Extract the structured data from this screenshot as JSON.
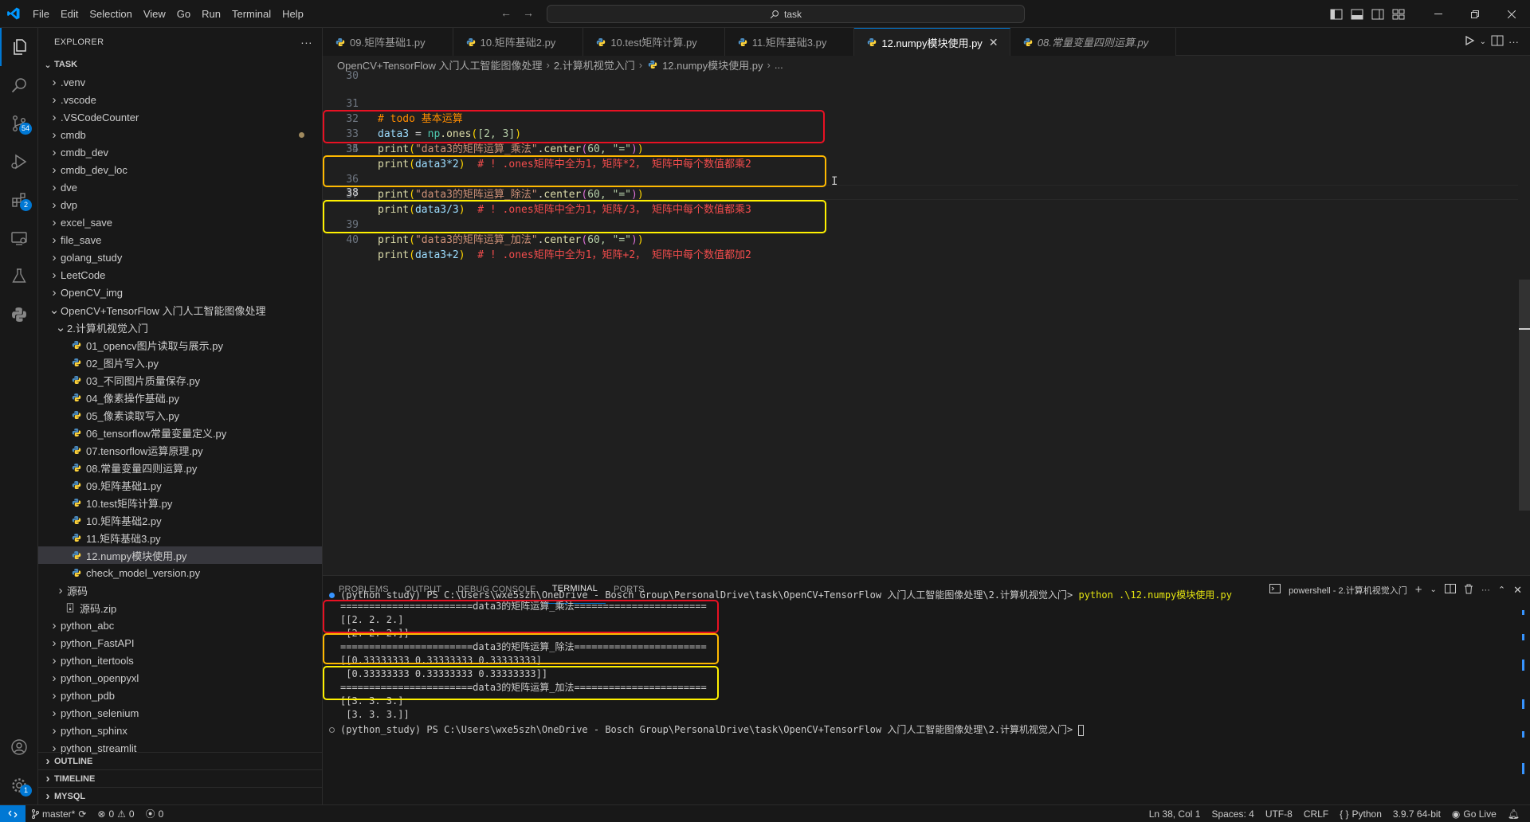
{
  "menu": [
    "File",
    "Edit",
    "Selection",
    "View",
    "Go",
    "Run",
    "Terminal",
    "Help"
  ],
  "nav": {
    "back": "←",
    "forward": "→"
  },
  "search": {
    "text": "task"
  },
  "explorer": {
    "title": "EXPLORER",
    "more": "···",
    "root": "TASK",
    "items": [
      {
        "label": ".venv",
        "kind": "folder",
        "depth": 1
      },
      {
        "label": ".vscode",
        "kind": "folder",
        "depth": 1
      },
      {
        "label": ".VSCodeCounter",
        "kind": "folder",
        "depth": 1
      },
      {
        "label": "cmdb",
        "kind": "folder",
        "depth": 1,
        "modified": true
      },
      {
        "label": "cmdb_dev",
        "kind": "folder",
        "depth": 1
      },
      {
        "label": "cmdb_dev_loc",
        "kind": "folder",
        "depth": 1
      },
      {
        "label": "dve",
        "kind": "folder",
        "depth": 1
      },
      {
        "label": "dvp",
        "kind": "folder",
        "depth": 1
      },
      {
        "label": "excel_save",
        "kind": "folder",
        "depth": 1
      },
      {
        "label": "file_save",
        "kind": "folder",
        "depth": 1
      },
      {
        "label": "golang_study",
        "kind": "folder",
        "depth": 1
      },
      {
        "label": "LeetCode",
        "kind": "folder",
        "depth": 1
      },
      {
        "label": "OpenCV_img",
        "kind": "folder",
        "depth": 1
      },
      {
        "label": "OpenCV+TensorFlow 入门人工智能图像处理",
        "kind": "folder-open",
        "depth": 1
      },
      {
        "label": "2.计算机视觉入门",
        "kind": "folder-open",
        "depth": 2
      },
      {
        "label": "01_opencv图片读取与展示.py",
        "kind": "py",
        "depth": 3
      },
      {
        "label": "02_图片写入.py",
        "kind": "py",
        "depth": 3
      },
      {
        "label": "03_不同图片质量保存.py",
        "kind": "py",
        "depth": 3
      },
      {
        "label": "04_像素操作基础.py",
        "kind": "py",
        "depth": 3
      },
      {
        "label": "05_像素读取写入.py",
        "kind": "py",
        "depth": 3
      },
      {
        "label": "06_tensorflow常量变量定义.py",
        "kind": "py",
        "depth": 3
      },
      {
        "label": "07.tensorflow运算原理.py",
        "kind": "py",
        "depth": 3
      },
      {
        "label": "08.常量变量四则运算.py",
        "kind": "py",
        "depth": 3
      },
      {
        "label": "09.矩阵基础1.py",
        "kind": "py",
        "depth": 3
      },
      {
        "label": "10.test矩阵计算.py",
        "kind": "py",
        "depth": 3
      },
      {
        "label": "10.矩阵基础2.py",
        "kind": "py",
        "depth": 3
      },
      {
        "label": "11.矩阵基础3.py",
        "kind": "py",
        "depth": 3
      },
      {
        "label": "12.numpy模块使用.py",
        "kind": "py",
        "depth": 3,
        "selected": true
      },
      {
        "label": "check_model_version.py",
        "kind": "py",
        "depth": 3
      },
      {
        "label": "源码",
        "kind": "folder",
        "depth": 2
      },
      {
        "label": "源码.zip",
        "kind": "zip",
        "depth": 2
      },
      {
        "label": "python_abc",
        "kind": "folder",
        "depth": 1
      },
      {
        "label": "python_FastAPI",
        "kind": "folder",
        "depth": 1
      },
      {
        "label": "python_itertools",
        "kind": "folder",
        "depth": 1
      },
      {
        "label": "python_openpyxl",
        "kind": "folder",
        "depth": 1
      },
      {
        "label": "python_pdb",
        "kind": "folder",
        "depth": 1
      },
      {
        "label": "python_selenium",
        "kind": "folder",
        "depth": 1
      },
      {
        "label": "python_sphinx",
        "kind": "folder",
        "depth": 1
      },
      {
        "label": "python_streamlit",
        "kind": "folder",
        "depth": 1
      }
    ],
    "sections": [
      "OUTLINE",
      "TIMELINE",
      "MYSQL"
    ]
  },
  "activity": {
    "scm_badge": "54",
    "ext_badge": "2",
    "settings_badge": "1"
  },
  "tabs": [
    {
      "label": "09.矩阵基础1.py",
      "active": false,
      "italic": false
    },
    {
      "label": "10.矩阵基础2.py",
      "active": false,
      "italic": false
    },
    {
      "label": "10.test矩阵计算.py",
      "active": false,
      "italic": false
    },
    {
      "label": "11.矩阵基础3.py",
      "active": false,
      "italic": false
    },
    {
      "label": "12.numpy模块使用.py",
      "active": true,
      "italic": false
    },
    {
      "label": "08.常量变量四则运算.py",
      "active": false,
      "italic": true
    }
  ],
  "breadcrumb": [
    "OpenCV+TensorFlow 入门人工智能图像处理",
    "2.计算机视觉入门",
    "12.numpy模块使用.py",
    "..."
  ],
  "editor": {
    "lines": [
      {
        "n": "30"
      },
      {
        "n": "31"
      },
      {
        "n": "32"
      },
      {
        "n": "33"
      },
      {
        "n": "34"
      },
      {
        "n": "35"
      },
      {
        "n": "36"
      },
      {
        "n": "37"
      },
      {
        "n": "38"
      },
      {
        "n": "39"
      },
      {
        "n": "40"
      }
    ],
    "todo_comment": "# todo 基本运算",
    "line32": {
      "var": "data3",
      "eq": " = ",
      "np": "np",
      "fn": ".ones",
      "args": "[2, 3]"
    },
    "line33": {
      "str": "\"data3的矩阵运算_乘法\"",
      "center_arg": "60, \"=\""
    },
    "line34": {
      "expr": "data3*2",
      "comment": "# ! .ones矩阵中全为1，矩阵*2， 矩阵中每个数值都乘2"
    },
    "line36": {
      "str": "\"data3的矩阵运算_除法\"",
      "center_arg": "60, \"=\""
    },
    "line37": {
      "expr": "data3/3",
      "comment": "# ! .ones矩阵中全为1，矩阵/3， 矩阵中每个数值都乘3"
    },
    "line39": {
      "str": "\"data3的矩阵运算_加法\"",
      "center_arg": "60, \"=\""
    },
    "line40": {
      "expr": "data3+2",
      "comment": "# ! .ones矩阵中全为1，矩阵+2， 矩阵中每个数值都加2"
    },
    "highlight_colors": {
      "red": "#e81123",
      "orange": "#ffb900",
      "yellow": "#fff100"
    }
  },
  "panel": {
    "tabs": [
      "PROBLEMS",
      "OUTPUT",
      "DEBUG CONSOLE",
      "TERMINAL",
      "PORTS"
    ],
    "active_tab": "TERMINAL",
    "shell_label": "powershell - 2.计算机视觉入门",
    "terminal": [
      "(python_study) PS C:\\Users\\wxe5szh\\OneDrive - Bosch Group\\PersonalDrive\\task\\OpenCV+TensorFlow 入门人工智能图像处理\\2.计算机视觉入门> ",
      "=======================data3的矩阵运算_乘法=======================",
      "[[2. 2. 2.]",
      " [2. 2. 2.]]",
      "=======================data3的矩阵运算_除法=======================",
      "[[0.33333333 0.33333333 0.33333333]",
      " [0.33333333 0.33333333 0.33333333]]",
      "=======================data3的矩阵运算_加法=======================",
      "[[3. 3. 3.]",
      " [3. 3. 3.]]",
      "(python_study) PS C:\\Users\\wxe5szh\\OneDrive - Bosch Group\\PersonalDrive\\task\\OpenCV+TensorFlow 入门人工智能图像处理\\2.计算机视觉入门> "
    ],
    "command": "python .\\12.numpy模块使用.py"
  },
  "status": {
    "branch": "master*",
    "errors": "0",
    "warnings": "0",
    "ports": "0",
    "position": "Ln 38, Col 1",
    "spaces": "Spaces: 4",
    "encoding": "UTF-8",
    "eol": "CRLF",
    "language": "Python",
    "interpreter": "3.9.7 64-bit",
    "golive": "Go Live"
  }
}
